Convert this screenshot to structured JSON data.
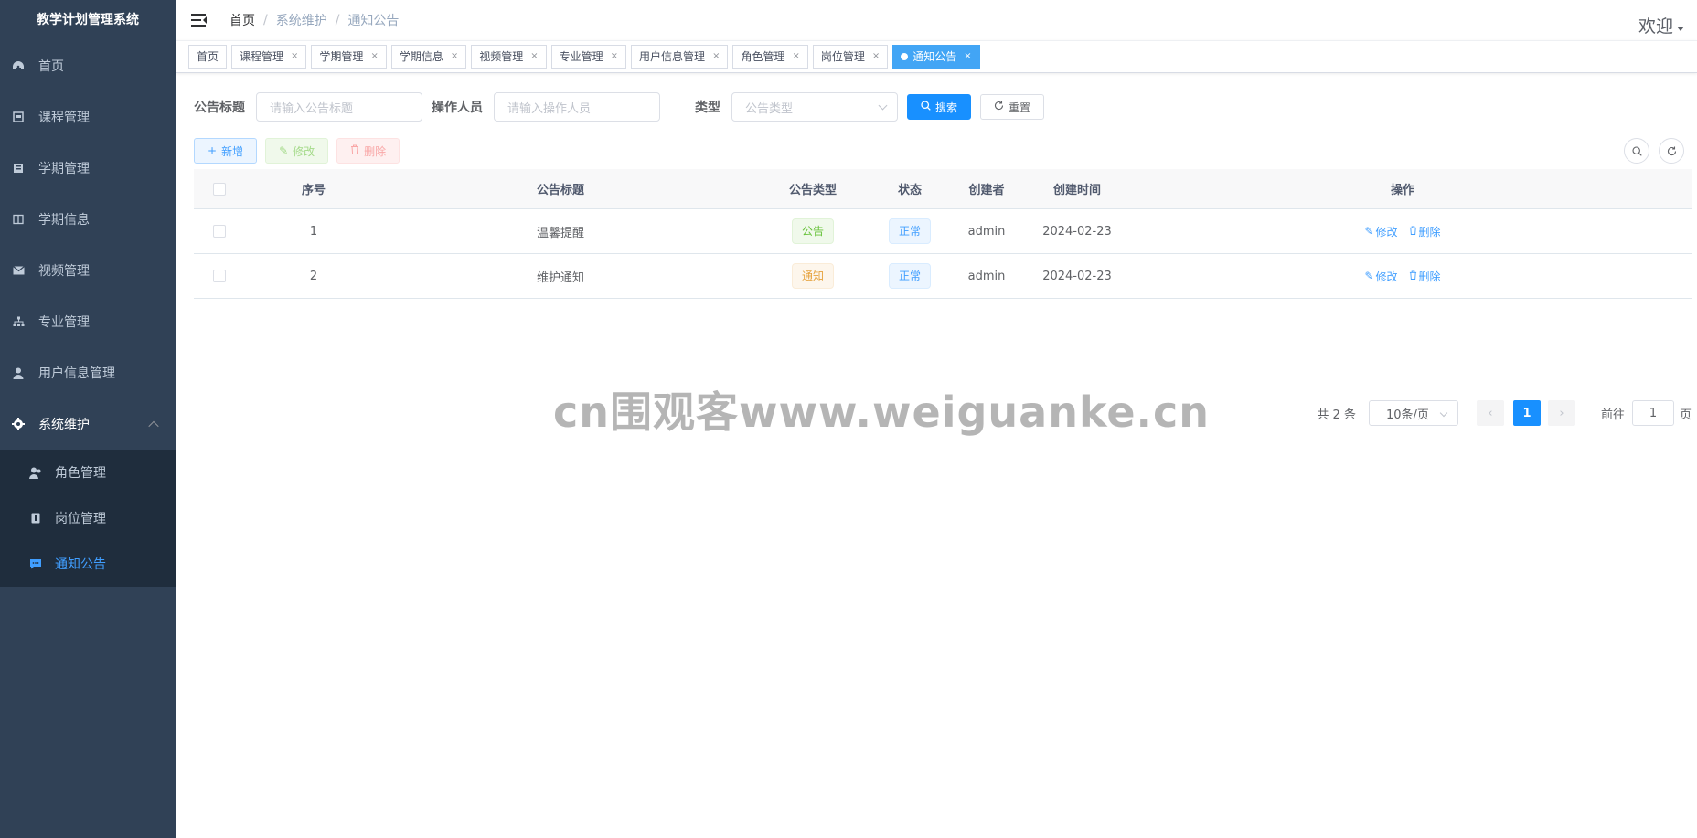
{
  "app": {
    "title": "教学计划管理系统"
  },
  "sidebar": {
    "items": [
      {
        "label": "首页",
        "icon": "dashboard-icon"
      },
      {
        "label": "课程管理",
        "icon": "course-icon"
      },
      {
        "label": "学期管理",
        "icon": "semester-icon"
      },
      {
        "label": "学期信息",
        "icon": "semester-info-icon"
      },
      {
        "label": "视频管理",
        "icon": "mail-icon"
      },
      {
        "label": "专业管理",
        "icon": "tree-icon"
      },
      {
        "label": "用户信息管理",
        "icon": "user-icon"
      },
      {
        "label": "系统维护",
        "icon": "gear-icon",
        "expanded": true
      }
    ],
    "sub_items": [
      {
        "label": "角色管理",
        "icon": "peoples-icon"
      },
      {
        "label": "岗位管理",
        "icon": "post-icon"
      },
      {
        "label": "通知公告",
        "icon": "message-icon",
        "active": true
      }
    ]
  },
  "navbar": {
    "breadcrumb": [
      "首页",
      "系统维护",
      "通知公告"
    ],
    "welcome": "欢迎"
  },
  "tabs": [
    {
      "label": "首页",
      "closable": false
    },
    {
      "label": "课程管理",
      "closable": true
    },
    {
      "label": "学期管理",
      "closable": true
    },
    {
      "label": "学期信息",
      "closable": true
    },
    {
      "label": "视频管理",
      "closable": true
    },
    {
      "label": "专业管理",
      "closable": true
    },
    {
      "label": "用户信息管理",
      "closable": true
    },
    {
      "label": "角色管理",
      "closable": true
    },
    {
      "label": "岗位管理",
      "closable": true
    },
    {
      "label": "通知公告",
      "closable": true,
      "active": true
    }
  ],
  "search": {
    "title_label": "公告标题",
    "title_placeholder": "请输入公告标题",
    "operator_label": "操作人员",
    "operator_placeholder": "请输入操作人员",
    "type_label": "类型",
    "type_placeholder": "公告类型",
    "search_button": "搜索",
    "reset_button": "重置"
  },
  "toolbar": {
    "add": "新增",
    "edit": "修改",
    "delete": "删除"
  },
  "table": {
    "columns": [
      "序号",
      "公告标题",
      "公告类型",
      "状态",
      "创建者",
      "创建时间",
      "操作"
    ],
    "rows": [
      {
        "index": "1",
        "title": "温馨提醒",
        "type": "公告",
        "status": "正常",
        "creator": "admin",
        "time": "2024-02-23",
        "edit": "修改",
        "delete": "删除"
      },
      {
        "index": "2",
        "title": "维护通知",
        "type": "通知",
        "status": "正常",
        "creator": "admin",
        "time": "2024-02-23",
        "edit": "修改",
        "delete": "删除"
      }
    ]
  },
  "pagination": {
    "total": "共 2 条",
    "page_size": "10条/页",
    "current_page": "1",
    "goto_prefix": "前往",
    "goto_value": "1",
    "goto_suffix": "页"
  },
  "watermark": "cn围观客www.weiguanke.cn",
  "colors": {
    "sidebar_bg": "#304156",
    "submenu_bg": "#1f2d3d",
    "active_text": "#409eff",
    "primary": "#1890ff",
    "active_tab": "#42a5f5"
  }
}
